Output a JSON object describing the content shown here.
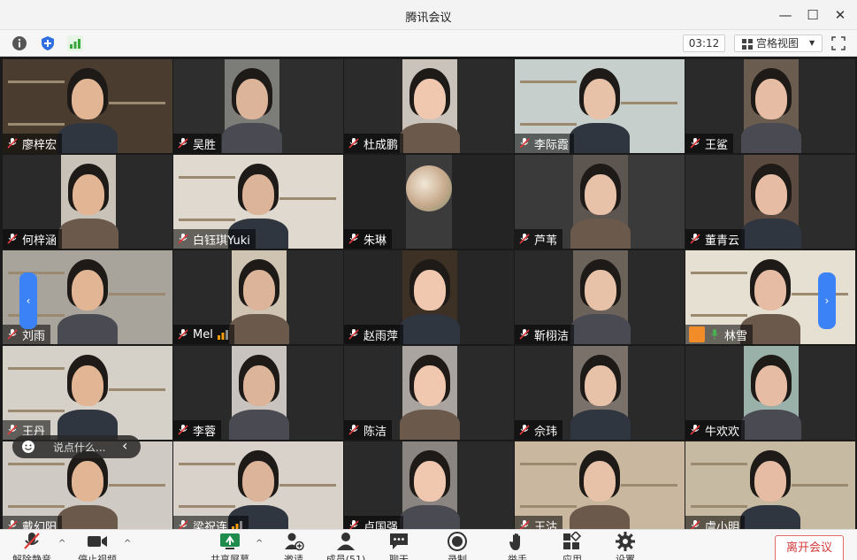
{
  "window": {
    "title": "腾讯会议",
    "minimize_glyph": "—",
    "maximize_glyph": "☐",
    "close_glyph": "✕"
  },
  "infobar": {
    "icons": [
      "info-icon",
      "shield-icon",
      "signal-icon"
    ],
    "timer": "03:12",
    "view_mode": "宫格视图",
    "view_caret": "▼"
  },
  "participants": [
    {
      "name": "廖梓宏",
      "muted": true
    },
    {
      "name": "吴胜",
      "muted": true
    },
    {
      "name": "杜成鹏",
      "muted": true
    },
    {
      "name": "李际霞",
      "muted": true
    },
    {
      "name": "王鲨",
      "muted": true
    },
    {
      "name": "何梓涵",
      "muted": true
    },
    {
      "name": "白钰琪Yuki",
      "muted": true
    },
    {
      "name": "朱琳",
      "muted": true
    },
    {
      "name": "芦苇",
      "muted": true
    },
    {
      "name": "董青云",
      "muted": true
    },
    {
      "name": "刘雨",
      "muted": true
    },
    {
      "name": "Mel",
      "muted": true,
      "speaking": true
    },
    {
      "name": "赵雨萍",
      "muted": true
    },
    {
      "name": "靳栩洁",
      "muted": true
    },
    {
      "name": "林雪",
      "muted": false,
      "host": true
    },
    {
      "name": "王丹",
      "muted": true
    },
    {
      "name": "李蓉",
      "muted": true
    },
    {
      "name": "陈洁",
      "muted": true
    },
    {
      "name": "佘玮",
      "muted": true
    },
    {
      "name": "牛欢欢",
      "muted": true
    },
    {
      "name": "戴幻阳",
      "muted": true
    },
    {
      "name": "梁祝连",
      "muted": true,
      "speaking": true
    },
    {
      "name": "卢国强",
      "muted": true
    },
    {
      "name": "王沽",
      "muted": true
    },
    {
      "name": "虞小明",
      "muted": true
    }
  ],
  "chat": {
    "placeholder": "说点什么...",
    "collapse_glyph": "‹"
  },
  "nav": {
    "left_arrow": "‹",
    "right_arrow": "›"
  },
  "toolbar": {
    "unmute": "解除静音",
    "stop_video": "停止视频",
    "share_screen": "共享屏幕",
    "invite": "邀请",
    "members": "成员(51)",
    "chat": "聊天",
    "record": "录制",
    "raise_hand": "举手",
    "apps": "应用",
    "settings": "设置",
    "leave": "离开会议",
    "caret": "^"
  },
  "colors": {
    "accent": "#3b82f6",
    "leave_red": "#d33a3a",
    "speaking_green": "#4caf50",
    "mic_muted": "#ffffff",
    "volume_orange": "#f59e0b"
  }
}
